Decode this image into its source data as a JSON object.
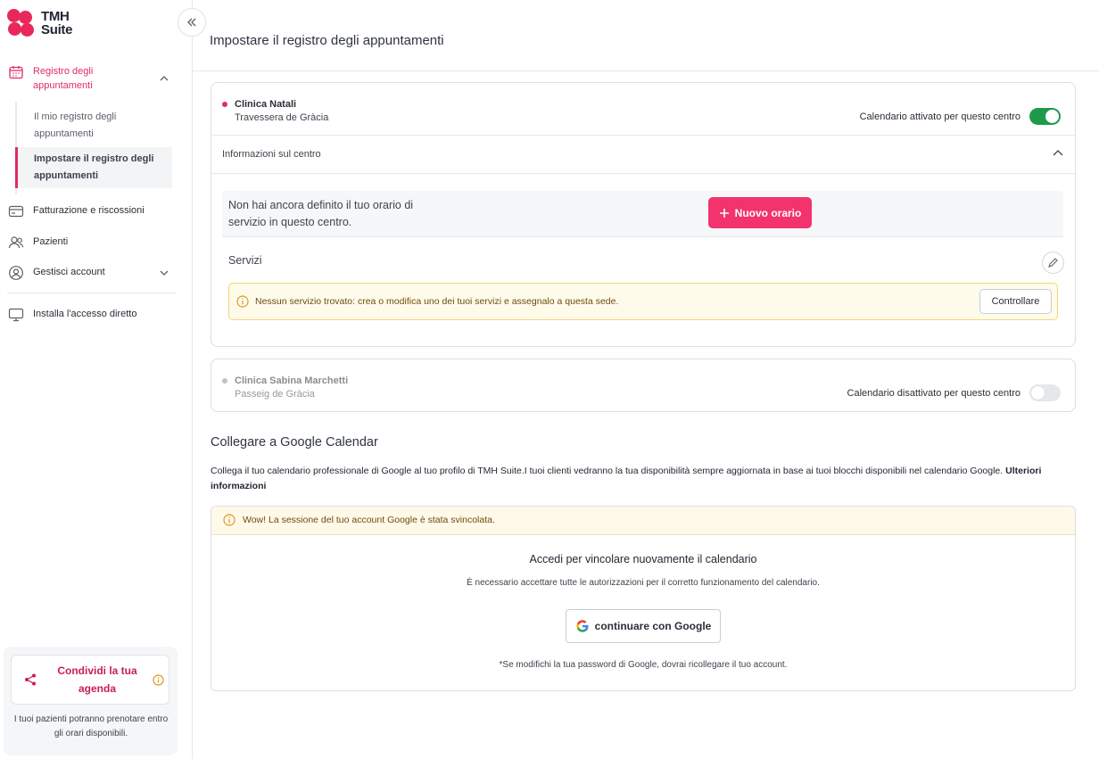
{
  "brand": {
    "line1": "TMH",
    "line2": "Suite",
    "color": "#e8285d"
  },
  "sidebar": {
    "registro": "Registro degli appuntamenti",
    "sub_items": [
      "Il mio registro degli appuntamenti",
      "Impostare il registro degli appuntamenti"
    ],
    "items": [
      "Fatturazione e riscossioni",
      "Pazienti",
      "Gestisci account"
    ],
    "install": "Installa l'accesso diretto",
    "share": {
      "label": "Condividi la tua agenda",
      "desc": "I tuoi pazienti potranno prenotare entro gli orari disponibili."
    }
  },
  "main": {
    "title": "Impostare il registro degli appuntamenti",
    "clinics": [
      {
        "name": "Clinica Natali",
        "address": "Travessera de Gràcia",
        "toggle_label": "Calendario attivato per questo centro",
        "active": true
      },
      {
        "name": "Clinica Sabina Marchetti",
        "address": "Passeig de Gràcia",
        "toggle_label": "Calendario disattivato per questo centro",
        "active": false
      }
    ],
    "info_label": "Informazioni sul centro",
    "schedule_text": "Non hai ancora definito il tuo orario di servizio in questo centro.",
    "new_schedule": "Nuovo orario",
    "services_label": "Servizi",
    "alert_text": "Nessun servizio trovato: crea o modifica uno dei tuoi servizi e assegnalo a questa sede.",
    "alert_button": "Controllare"
  },
  "google": {
    "title": "Collegare a Google Calendar",
    "desc": "Collega il tuo calendario professionale di Google al tuo profilo di TMH Suite.I tuoi clienti vedranno la tua disponibilità sempre aggiornata in base ai tuoi blocchi disponibili nel calendario Google.",
    "more": "Ulteriori informazioni",
    "warning": "Wow! La sessione del tuo account Google è stata svincolata.",
    "heading": "Accedi per vincolare nuovamente il calendario",
    "sub": "È necessario accettare tutte le autorizzazioni per il corretto funzionamento del calendario.",
    "button": "continuare con Google",
    "note": "*Se modifichi la tua password di Google, dovrai ricollegare il tuo account."
  }
}
